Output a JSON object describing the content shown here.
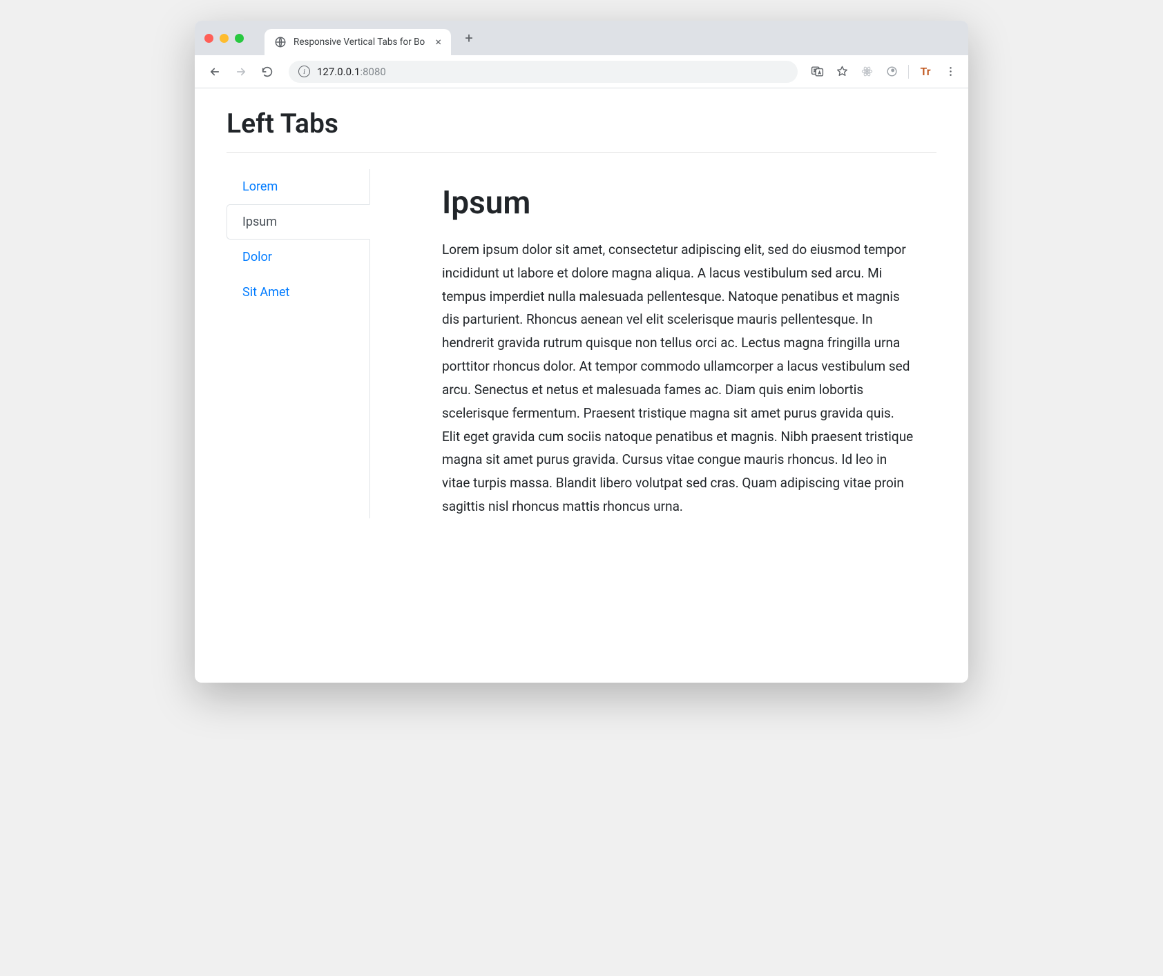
{
  "browser": {
    "tab_title": "Responsive Vertical Tabs for Boo",
    "url_host": "127.0.0.1",
    "url_port": ":8080",
    "tr_label": "Tr"
  },
  "page": {
    "heading": "Left Tabs",
    "tabs": [
      {
        "label": "Lorem",
        "active": false
      },
      {
        "label": "Ipsum",
        "active": true
      },
      {
        "label": "Dolor",
        "active": false
      },
      {
        "label": "Sit Amet",
        "active": false
      }
    ],
    "content": {
      "heading": "Ipsum",
      "body": "Lorem ipsum dolor sit amet, consectetur adipiscing elit, sed do eiusmod tempor incididunt ut labore et dolore magna aliqua. A lacus vestibulum sed arcu. Mi tempus imperdiet nulla malesuada pellentesque. Natoque penatibus et magnis dis parturient. Rhoncus aenean vel elit scelerisque mauris pellentesque. In hendrerit gravida rutrum quisque non tellus orci ac. Lectus magna fringilla urna porttitor rhoncus dolor. At tempor commodo ullamcorper a lacus vestibulum sed arcu. Senectus et netus et malesuada fames ac. Diam quis enim lobortis scelerisque fermentum. Praesent tristique magna sit amet purus gravida quis. Elit eget gravida cum sociis natoque penatibus et magnis. Nibh praesent tristique magna sit amet purus gravida. Cursus vitae congue mauris rhoncus. Id leo in vitae turpis massa. Blandit libero volutpat sed cras. Quam adipiscing vitae proin sagittis nisl rhoncus mattis rhoncus urna."
    }
  }
}
